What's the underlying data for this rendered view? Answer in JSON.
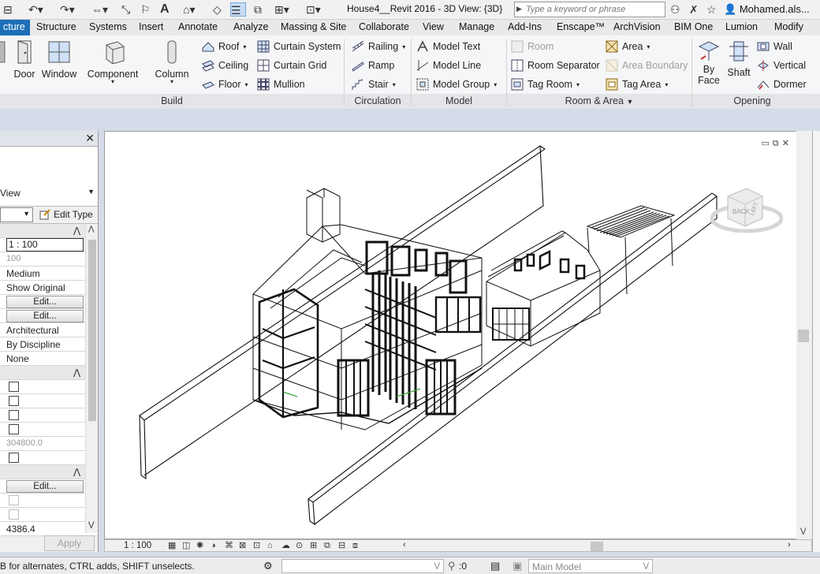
{
  "titlebar": {
    "title": "House4__Revit 2016 - 3D View: {3D}",
    "search_placeholder": "Type a keyword or phrase",
    "user": "Mohamed.als..."
  },
  "tabs": [
    "cture",
    "Structure",
    "Systems",
    "Insert",
    "Annotate",
    "Analyze",
    "Massing & Site",
    "Collaborate",
    "View",
    "Manage",
    "Add-Ins",
    "Enscape™",
    "ArchVision",
    "BIM One",
    "Lumion",
    "Modify"
  ],
  "ribbon": {
    "build": {
      "label": "Build",
      "door": "Door",
      "window": "Window",
      "component": "Component",
      "column": "Column",
      "roof": "Roof",
      "ceiling": "Ceiling",
      "floor": "Floor",
      "curtain_system": "Curtain System",
      "curtain_grid": "Curtain Grid",
      "mullion": "Mullion"
    },
    "circulation": {
      "label": "Circulation",
      "railing": "Railing",
      "ramp": "Ramp",
      "stair": "Stair"
    },
    "model": {
      "label": "Model",
      "model_text": "Model Text",
      "model_line": "Model Line",
      "model_group": "Model Group"
    },
    "room_area": {
      "label": "Room & Area",
      "room": "Room",
      "room_separator": "Room Separator",
      "tag_room": "Tag Room",
      "area": "Area",
      "area_boundary": "Area Boundary",
      "tag_area": "Tag Area"
    },
    "opening": {
      "label": "Opening",
      "by_face_1": "By",
      "by_face_2": "Face",
      "shaft": "Shaft",
      "wall": "Wall",
      "vertical": "Vertical",
      "dormer": "Dormer"
    }
  },
  "properties": {
    "type_label": "View",
    "edit_type": "Edit Type",
    "rows": {
      "view_scale": "1 : 100",
      "scale_value": "100",
      "detail_level": "Medium",
      "parts_visibility": "Show Original",
      "edit_1": "Edit...",
      "edit_2": "Edit...",
      "discipline": "Architectural",
      "show_hidden": "By Discipline",
      "sun_path": "None",
      "distance": "304800.0",
      "edit_3": "Edit...",
      "elevation": "4386.4"
    },
    "apply": "Apply"
  },
  "viewcube": {
    "face": "BACK",
    "side": "LEFT"
  },
  "viewbar": {
    "scale": "1 : 100"
  },
  "status": {
    "message": "B for alternates, CTRL adds, SHIFT unselects.",
    "selected_count": ":0",
    "workset": "Main Model"
  }
}
